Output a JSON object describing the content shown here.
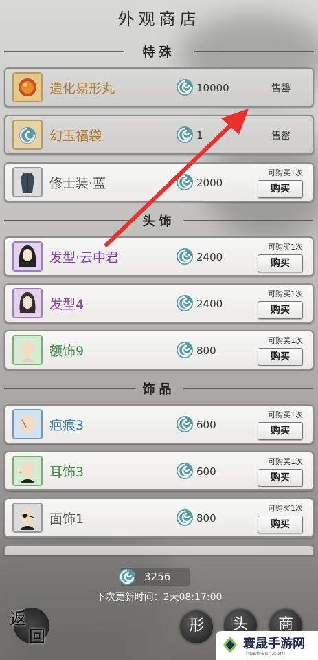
{
  "header": {
    "title": "外观商店"
  },
  "sections": {
    "special": "特殊",
    "headwear": "头饰",
    "accessory": "饰品"
  },
  "items": [
    {
      "name": "造化易形丸",
      "price": "10000",
      "status": "售罄",
      "name_color": "#b07a2a"
    },
    {
      "name": "幻玉福袋",
      "price": "1",
      "status": "售罄",
      "name_color": "#b07a2a"
    },
    {
      "name": "修士装·蓝",
      "price": "2000",
      "limit": "可购买1次",
      "button": "购买",
      "name_color": "#555555"
    },
    {
      "name": "发型·云中君",
      "price": "2400",
      "limit": "可购买1次",
      "button": "购买",
      "name_color": "#8a3fb0"
    },
    {
      "name": "发型4",
      "price": "2400",
      "limit": "可购买1次",
      "button": "购买",
      "name_color": "#8a3fb0"
    },
    {
      "name": "额饰9",
      "price": "800",
      "limit": "可购买1次",
      "button": "购买",
      "name_color": "#3f8a3f"
    },
    {
      "name": "疤痕3",
      "price": "600",
      "limit": "可购买1次",
      "button": "购买",
      "name_color": "#3a7fb0"
    },
    {
      "name": "耳饰3",
      "price": "600",
      "limit": "可购买1次",
      "button": "购买",
      "name_color": "#3f8a3f"
    },
    {
      "name": "面饰1",
      "price": "800",
      "limit": "可购买1次",
      "button": "购买",
      "name_color": "#555555"
    }
  ],
  "footer": {
    "currency": "3256",
    "refresh_text": "下次更新时间：2天08:17:00",
    "back_char1": "返",
    "back_char2": "回",
    "nav1": "形",
    "nav2": "头",
    "nav3": "商"
  },
  "watermark": {
    "title": "寰晟手游网",
    "url": "huan-sun.com"
  }
}
